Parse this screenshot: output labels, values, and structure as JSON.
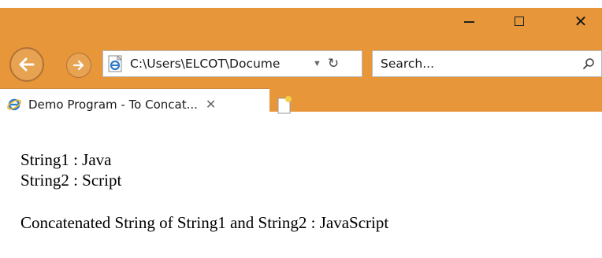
{
  "window": {
    "minimize_icon": "minimize-icon",
    "maximize_icon": "maximize-icon",
    "close_label": "✕"
  },
  "toolbar": {
    "address": "C:\\Users\\ELCOT\\Docume",
    "dropdown": "▼",
    "refresh": "↻",
    "search_placeholder": "Search..."
  },
  "tabs": [
    {
      "label": "Demo Program - To Concat...",
      "close": "✕"
    }
  ],
  "page": {
    "line1": "String1 : Java",
    "line2": "String2 : Script",
    "line3": "Concatenated String of String1 and String2 : JavaScript"
  }
}
